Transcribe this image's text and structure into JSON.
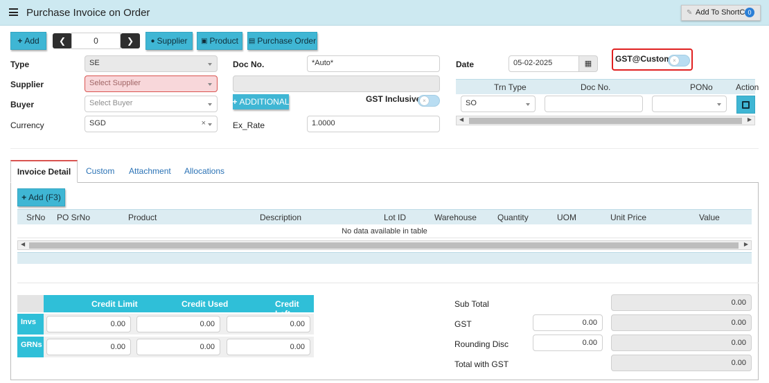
{
  "header": {
    "title": "Purchase Invoice on Order",
    "shortcut_label": "Add To ShortCut",
    "shortcut_count": "0"
  },
  "toolbar": {
    "add_label": "Add",
    "record_number": "0",
    "supplier_label": "Supplier",
    "product_label": "Product",
    "purchase_order_label": "Purchase Order"
  },
  "form": {
    "type_label": "Type",
    "type_value": "SE",
    "supplier_label": "Supplier",
    "supplier_placeholder": "Select Supplier",
    "buyer_label": "Buyer",
    "buyer_placeholder": "Select Buyer",
    "currency_label": "Currency",
    "currency_value": "SGD",
    "docno_label": "Doc No.",
    "docno_value": "*Auto*",
    "additional_label": "ADDITIONAL",
    "gst_inclusive_label": "GST Inclusive",
    "exrate_label": "Ex_Rate",
    "exrate_value": "1.0000",
    "date_label": "Date",
    "date_value": "05-02-2025",
    "gst_custom_label": "GST@Custom"
  },
  "trn_table": {
    "headers": [
      "Trn Type",
      "Doc No.",
      "PONo",
      "Action"
    ],
    "trn_type_value": "SO"
  },
  "tabs": [
    "Invoice Detail",
    "Custom",
    "Attachment",
    "Allocations"
  ],
  "detail": {
    "add_label": "Add (F3)",
    "columns": [
      "SrNo",
      "PO SrNo",
      "Product",
      "Description",
      "Lot ID",
      "Warehouse",
      "Quantity",
      "UOM",
      "Unit Price",
      "Value"
    ],
    "empty_message": "No data available in table"
  },
  "credit": {
    "headers": [
      "Credit Limit",
      "Credit Used",
      "Credit Left"
    ],
    "rows": [
      {
        "label": "Invs",
        "values": [
          "0.00",
          "0.00",
          "0.00"
        ]
      },
      {
        "label": "GRNs",
        "values": [
          "0.00",
          "0.00",
          "0.00"
        ]
      }
    ]
  },
  "totals": {
    "subtotal_label": "Sub Total",
    "subtotal_value": "0.00",
    "gst_label": "GST",
    "gst_input": "0.00",
    "gst_value": "0.00",
    "rounding_label": "Rounding Disc",
    "rounding_input": "0.00",
    "rounding_value": "0.00",
    "total_label": "Total with GST",
    "total_value": "0.00"
  },
  "colors": {
    "accent": "#3fb6d4",
    "grid_header": "#2fbfd8",
    "header_bg": "#cde9f1",
    "error": "#d9534f"
  }
}
